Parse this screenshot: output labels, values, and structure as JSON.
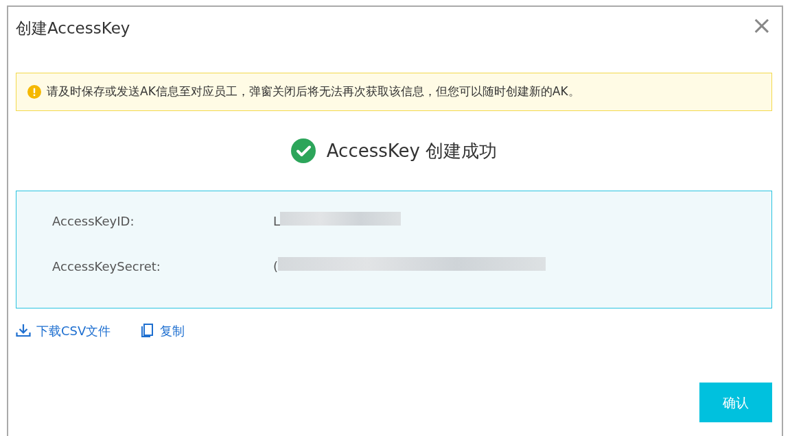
{
  "dialog": {
    "title": "创建AccessKey",
    "close": "×"
  },
  "warning": {
    "text": "请及时保存或发送AK信息至对应员工，弹窗关闭后将无法再次获取该信息，但您可以随时创建新的AK。"
  },
  "success": {
    "text": "AccessKey 创建成功"
  },
  "fields": [
    {
      "label": "AccessKeyID:",
      "value": "L",
      "redacted": true
    },
    {
      "label": "AccessKeySecret:",
      "value": "(",
      "redacted": true
    }
  ],
  "actions": [
    {
      "kind": "download",
      "label": "下载CSV文件"
    },
    {
      "kind": "copy",
      "label": "复制"
    }
  ],
  "confirm_button": "确认"
}
